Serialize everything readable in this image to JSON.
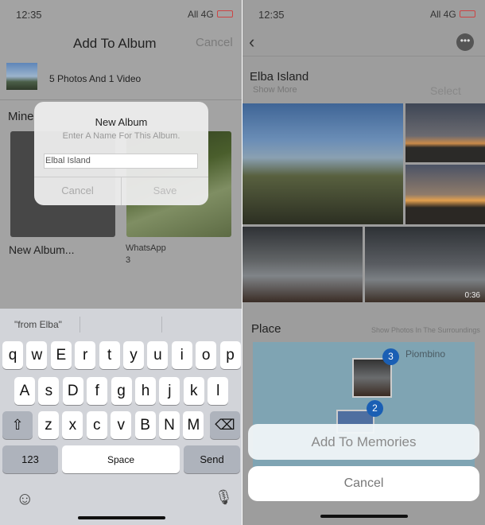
{
  "left": {
    "status": {
      "time": "12:35",
      "network": "All 4G"
    },
    "nav": {
      "title": "Add To Album",
      "cancel": "Cancel"
    },
    "selection": {
      "summary": "5 Photos And 1 Video"
    },
    "section_title": "Mine",
    "albums": [
      {
        "name": "New Album...",
        "count": ""
      },
      {
        "name": "WhatsApp",
        "count": "3"
      }
    ],
    "dialog": {
      "title": "New Album",
      "message": "Enter A Name For This Album.",
      "input_value": "Elbal Island",
      "cancel": "Cancel",
      "save": "Save"
    },
    "keyboard": {
      "suggestion": "\"from Elba\"",
      "row1": [
        "q",
        "w",
        "E",
        "r",
        "t",
        "y",
        "u",
        "i",
        "o",
        "p"
      ],
      "row2": [
        "A",
        "s",
        "D",
        "f",
        "g",
        "h",
        "j",
        "k",
        "l"
      ],
      "row3": [
        "z",
        "x",
        "c",
        "v",
        "B",
        "N",
        "M"
      ],
      "numbers": "123",
      "space": "Space",
      "send": "Send"
    }
  },
  "right": {
    "status": {
      "time": "12:35",
      "network": "All 4G"
    },
    "album_title": "Elba Island",
    "show_more": "Show More",
    "select": "Select",
    "video_duration": "0:36",
    "place_title": "Place",
    "place_link": "Show Photos In The Surroundings",
    "map": {
      "city": "Piombino",
      "cluster_counts": [
        "3",
        "2"
      ]
    },
    "actions": {
      "add": "Add To Memories",
      "cancel": "Cancel"
    }
  },
  "colors": {
    "badge": "#1a5fb4",
    "map_water": "#7fa4b3"
  }
}
